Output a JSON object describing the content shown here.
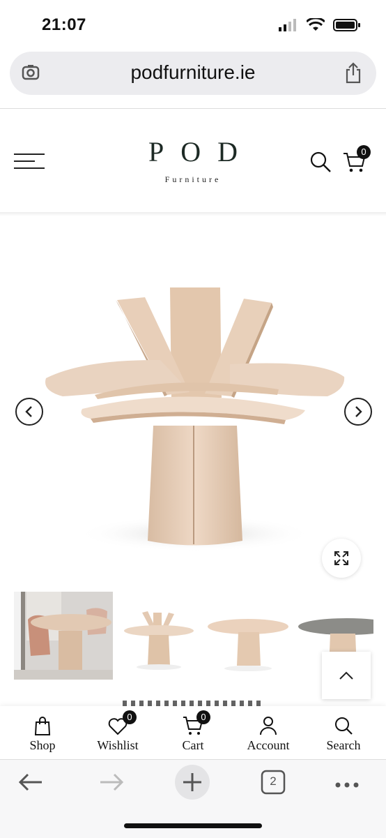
{
  "status": {
    "time": "21:07"
  },
  "browser": {
    "url": "podfurniture.ie",
    "tab_count": "2"
  },
  "site": {
    "logo": "POD",
    "logo_sub": "Furniture",
    "cart_count": "0"
  },
  "bottom_nav": [
    {
      "label": "Shop",
      "icon": "bag-icon"
    },
    {
      "label": "Wishlist",
      "icon": "heart-icon",
      "badge": "0"
    },
    {
      "label": "Cart",
      "icon": "cart-icon",
      "badge": "0"
    },
    {
      "label": "Account",
      "icon": "user-icon"
    },
    {
      "label": "Search",
      "icon": "search-icon"
    }
  ],
  "colors": {
    "wood": "#e6cdb6",
    "wood_dark": "#c9a98c",
    "logo": "#1d2a25"
  }
}
